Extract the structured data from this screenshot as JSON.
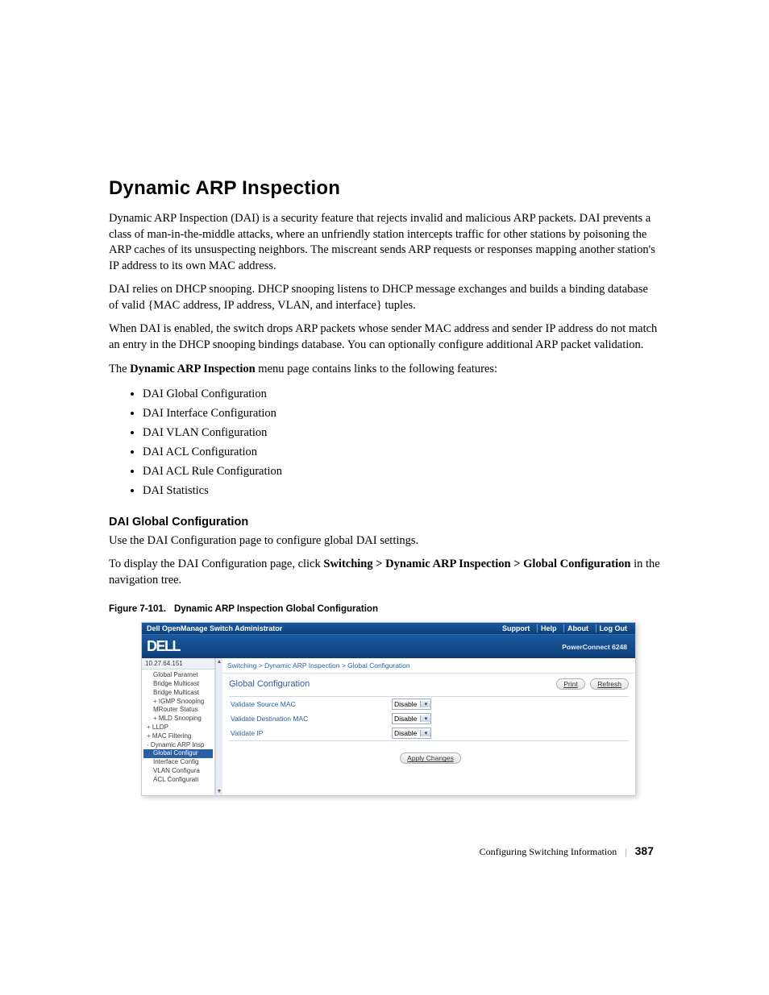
{
  "heading": "Dynamic ARP Inspection",
  "para1": "Dynamic ARP Inspection (DAI) is a security feature that rejects invalid and malicious ARP packets. DAI prevents a class of man-in-the-middle attacks, where an unfriendly station intercepts traffic for other stations by poisoning the ARP caches of its unsuspecting neighbors. The miscreant sends ARP requests or responses mapping another station's IP address to its own MAC address.",
  "para2": "DAI relies on DHCP snooping. DHCP snooping listens to DHCP message exchanges and builds a binding database of valid {MAC address, IP address, VLAN, and interface} tuples.",
  "para3": "When DAI is enabled, the switch drops ARP packets whose sender MAC address and sender IP address do not match an entry in the DHCP snooping bindings database. You can optionally configure additional ARP packet validation.",
  "para4_a": "The ",
  "para4_b": "Dynamic ARP Inspection",
  "para4_c": " menu page contains links to the following features:",
  "features": [
    "DAI Global Configuration",
    "DAI Interface Configuration",
    "DAI VLAN Configuration",
    "DAI ACL Configuration",
    "DAI ACL Rule Configuration",
    "DAI Statistics"
  ],
  "sub_heading": "DAI Global Configuration",
  "sub_para1": "Use the DAI Configuration page to configure global DAI settings.",
  "sub_para2_a": "To display the DAI Configuration page, click ",
  "sub_para2_b": "Switching > Dynamic ARP Inspection > Global Configuration",
  "sub_para2_c": " in the navigation tree.",
  "figure": {
    "num": "Figure 7-101.",
    "title": "Dynamic ARP Inspection Global Configuration"
  },
  "screenshot": {
    "topbar_title": "Dell OpenManage Switch Administrator",
    "top_links": [
      "Support",
      "Help",
      "About",
      "Log Out"
    ],
    "logo": "DELL",
    "device": "PowerConnect 6248",
    "ip": "10.27.64.151",
    "tree": {
      "items": [
        {
          "label": "Global Paramet",
          "cls": "lvl2"
        },
        {
          "label": "Bridge Multicast",
          "cls": "lvl2"
        },
        {
          "label": "Bridge Multicast",
          "cls": "lvl2"
        },
        {
          "label": "IGMP Snooping",
          "cls": "lvl2 exp"
        },
        {
          "label": "MRouter Status",
          "cls": "lvl2"
        },
        {
          "label": "MLD Snooping",
          "cls": "lvl2 exp"
        },
        {
          "label": "LLDP",
          "cls": "lvl1 exp"
        },
        {
          "label": "MAC Filtering",
          "cls": "lvl1 exp"
        },
        {
          "label": "Dynamic ARP Insp",
          "cls": "lvl1 col"
        },
        {
          "label": "Global Configur",
          "cls": "lvl2 sel"
        },
        {
          "label": "Interface Config",
          "cls": "lvl2"
        },
        {
          "label": "VLAN Configura",
          "cls": "lvl2"
        },
        {
          "label": "ACL Configurati",
          "cls": "lvl2"
        }
      ]
    },
    "breadcrumb": "Switching > Dynamic ARP Inspection > Global Configuration",
    "panel_title": "Global Configuration",
    "btn_print": "Print",
    "btn_refresh": "Refresh",
    "rows": [
      {
        "label": "Validate Source MAC",
        "value": "Disable"
      },
      {
        "label": "Validate Destination MAC",
        "value": "Disable"
      },
      {
        "label": "Validate IP",
        "value": "Disable"
      }
    ],
    "apply": "Apply Changes"
  },
  "footer": {
    "section": "Configuring Switching Information",
    "page": "387"
  }
}
